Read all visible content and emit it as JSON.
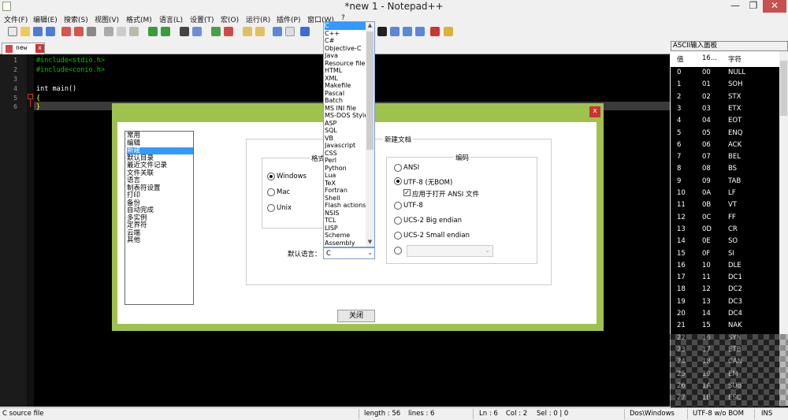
{
  "window": {
    "title": "*new 1 - Notepad++",
    "min": "—",
    "max": "❐",
    "close": "✕"
  },
  "menu": [
    "文件(F)",
    "编辑(E)",
    "搜索(S)",
    "视图(V)",
    "格式(M)",
    "语言(L)",
    "设置(T)",
    "宏(O)",
    "运行(R)",
    "插件(P)",
    "窗口(W)",
    "?"
  ],
  "tab": {
    "label": "new",
    "close": "x"
  },
  "editor": {
    "line_numbers": [
      "1",
      "2",
      "3",
      "4",
      "5",
      "6"
    ],
    "code": [
      "#include<stdio.h>",
      "#include<conio.h>",
      "",
      "int main()",
      "{",
      "}"
    ],
    "colors": {
      "include": "#00c800",
      "keyword": "#ffffff",
      "paren": "#ffff00"
    }
  },
  "dialog": {
    "close": "x",
    "pref_items": [
      "常用",
      "编辑",
      "新建",
      "默认目录",
      "最近文件记录",
      "文件关联",
      "语言",
      "制表符设置",
      "打印",
      "备份",
      "自动完成",
      "多实例",
      "定界符",
      "云端",
      "其他"
    ],
    "pref_selected": 2,
    "format_group": "格式",
    "format_options": [
      "Windows",
      "Mac",
      "Unix"
    ],
    "newdoc_group": "新建文档",
    "encoding_group": "编码",
    "encoding_options": [
      "ANSI",
      "UTF-8 (无BOM)",
      "UTF-8",
      "UCS-2 Big endian",
      "UCS-2 Small endian"
    ],
    "ansi_checkbox": "应用于打开 ANSI 文件",
    "default_lang_label": "默认语言：",
    "default_lang_value": "C",
    "lang_options": [
      "C",
      "C++",
      "C#",
      "Objective-C",
      "Java",
      "Resource file",
      "HTML",
      "XML",
      "Makefile",
      "Pascal",
      "Batch",
      "MS INI file",
      "MS-DOS Style",
      "ASP",
      "SQL",
      "VB",
      "Javascript",
      "CSS",
      "Perl",
      "Python",
      "Lua",
      "TeX",
      "Fortran",
      "Shell",
      "Flash actionscr",
      "NSIS",
      "TCL",
      "LISP",
      "Scheme",
      "Assembly"
    ],
    "close_button": "关闭"
  },
  "ascii": {
    "title": "ASCII输入面板",
    "headers": [
      "值",
      "16...",
      "字符"
    ],
    "rows": [
      [
        "0",
        "00",
        "NULL"
      ],
      [
        "1",
        "01",
        "SOH"
      ],
      [
        "2",
        "02",
        "STX"
      ],
      [
        "3",
        "03",
        "ETX"
      ],
      [
        "4",
        "04",
        "EOT"
      ],
      [
        "5",
        "05",
        "ENQ"
      ],
      [
        "6",
        "06",
        "ACK"
      ],
      [
        "7",
        "07",
        "BEL"
      ],
      [
        "8",
        "08",
        "BS"
      ],
      [
        "9",
        "09",
        "TAB"
      ],
      [
        "10",
        "0A",
        "LF"
      ],
      [
        "11",
        "0B",
        "VT"
      ],
      [
        "12",
        "0C",
        "FF"
      ],
      [
        "13",
        "0D",
        "CR"
      ],
      [
        "14",
        "0E",
        "SO"
      ],
      [
        "15",
        "0F",
        "SI"
      ],
      [
        "16",
        "10",
        "DLE"
      ],
      [
        "17",
        "11",
        "DC1"
      ],
      [
        "18",
        "12",
        "DC2"
      ],
      [
        "19",
        "13",
        "DC3"
      ],
      [
        "20",
        "14",
        "DC4"
      ],
      [
        "21",
        "15",
        "NAK"
      ],
      [
        "22",
        "16",
        "SYN"
      ],
      [
        "23",
        "17",
        "ETB"
      ],
      [
        "24",
        "18",
        "CAN"
      ],
      [
        "25",
        "19",
        "EM"
      ],
      [
        "26",
        "1A",
        "SUB"
      ],
      [
        "27",
        "1B",
        "ESC"
      ]
    ]
  },
  "status": {
    "file_type": "C source file",
    "length": "length : 56",
    "lines": "lines : 6",
    "ln": "Ln : 6",
    "col": "Col : 2",
    "sel": "Sel : 0 | 0",
    "eol": "Dos\\Windows",
    "encoding": "UTF-8 w/o BOM",
    "mode": "INS"
  }
}
